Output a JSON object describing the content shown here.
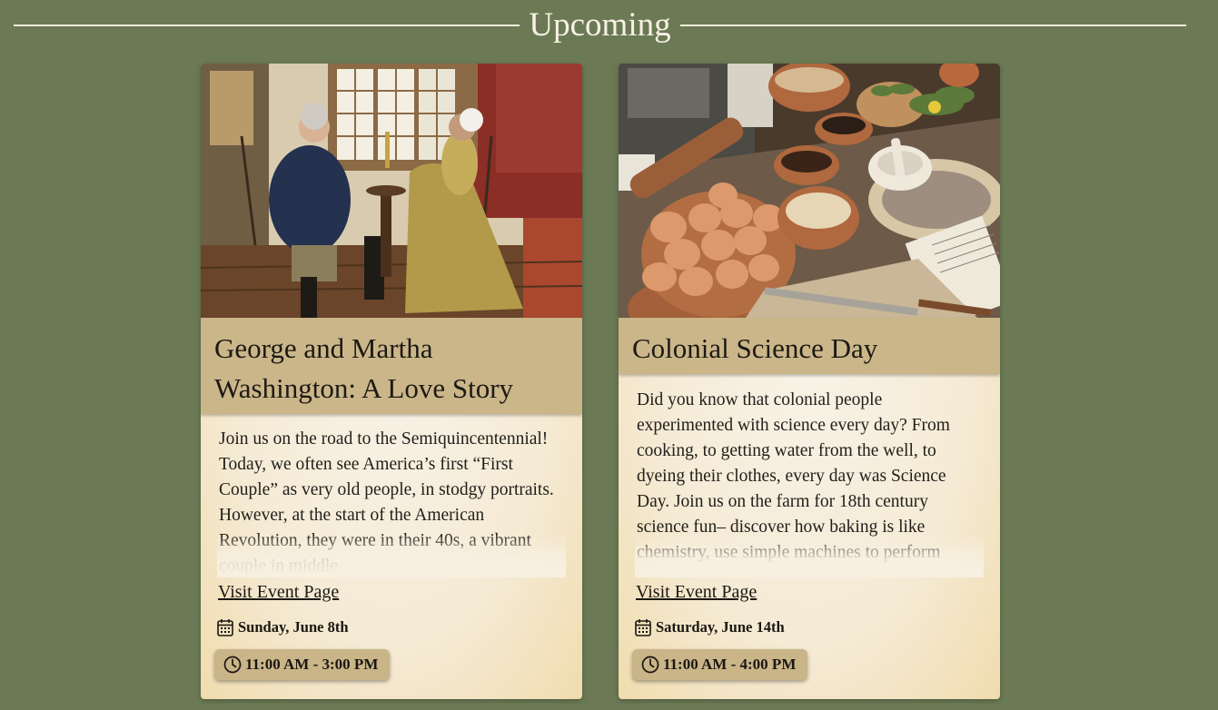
{
  "section": {
    "title": "Upcoming"
  },
  "events": [
    {
      "title": "George and Martha Washington: A Love Story",
      "description": "Join us on the road to the Semiquincentennial! Today, we often see America’s first “First Couple” as very old people, in stodgy portraits. However, at the start of the American Revolution, they were in their 40s, a vibrant couple in middle",
      "link_label": "Visit Event Page",
      "date": "Sunday, June 8th",
      "time": "11:00 AM - 3:00 PM"
    },
    {
      "title": "Colonial Science Day",
      "description": "Did you know that colonial people experimented with science every day? From cooking, to getting water from the well, to dyeing their clothes, every day was Science Day. Join us on the farm for 18th century science fun– discover how baking is like chemistry, use simple machines to perform",
      "link_label": "Visit Event Page",
      "date": "Saturday, June 14th",
      "time": "11:00 AM - 4:00 PM"
    }
  ]
}
